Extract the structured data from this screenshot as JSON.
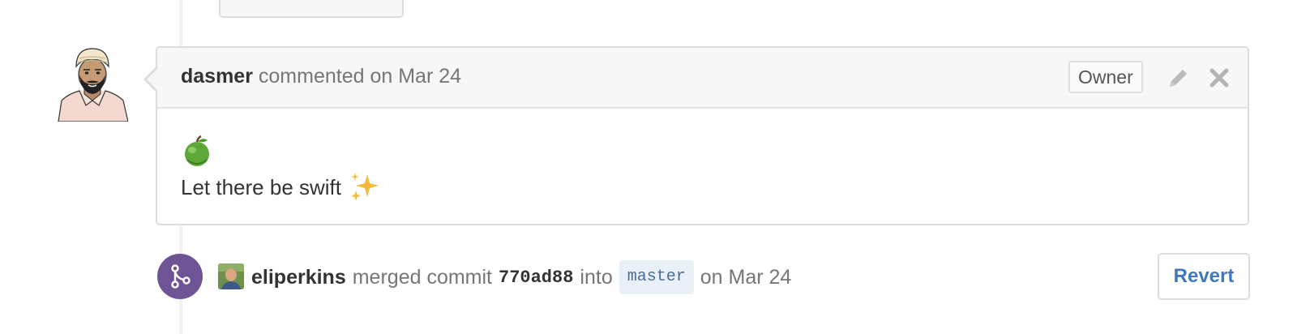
{
  "comment": {
    "author": "dasmer",
    "action_text": "commented on Mar 24",
    "badge": "Owner",
    "body_emoji_top": "green-apple",
    "body_text": "Let there be swift",
    "body_emoji_end": "sparkles",
    "icons": [
      "pencil-icon",
      "close-icon"
    ]
  },
  "merge_event": {
    "author": "eliperkins",
    "action_text": "merged commit",
    "commit": "770ad88",
    "into_text": "into",
    "branch": "master",
    "date_text": "on Mar 24",
    "revert_label": "Revert",
    "icon": "git-merge-icon",
    "icon_color": "#6e5494"
  },
  "colors": {
    "link": "#4078c0",
    "header_bg": "#f7f7f7",
    "border": "#dddddd"
  }
}
